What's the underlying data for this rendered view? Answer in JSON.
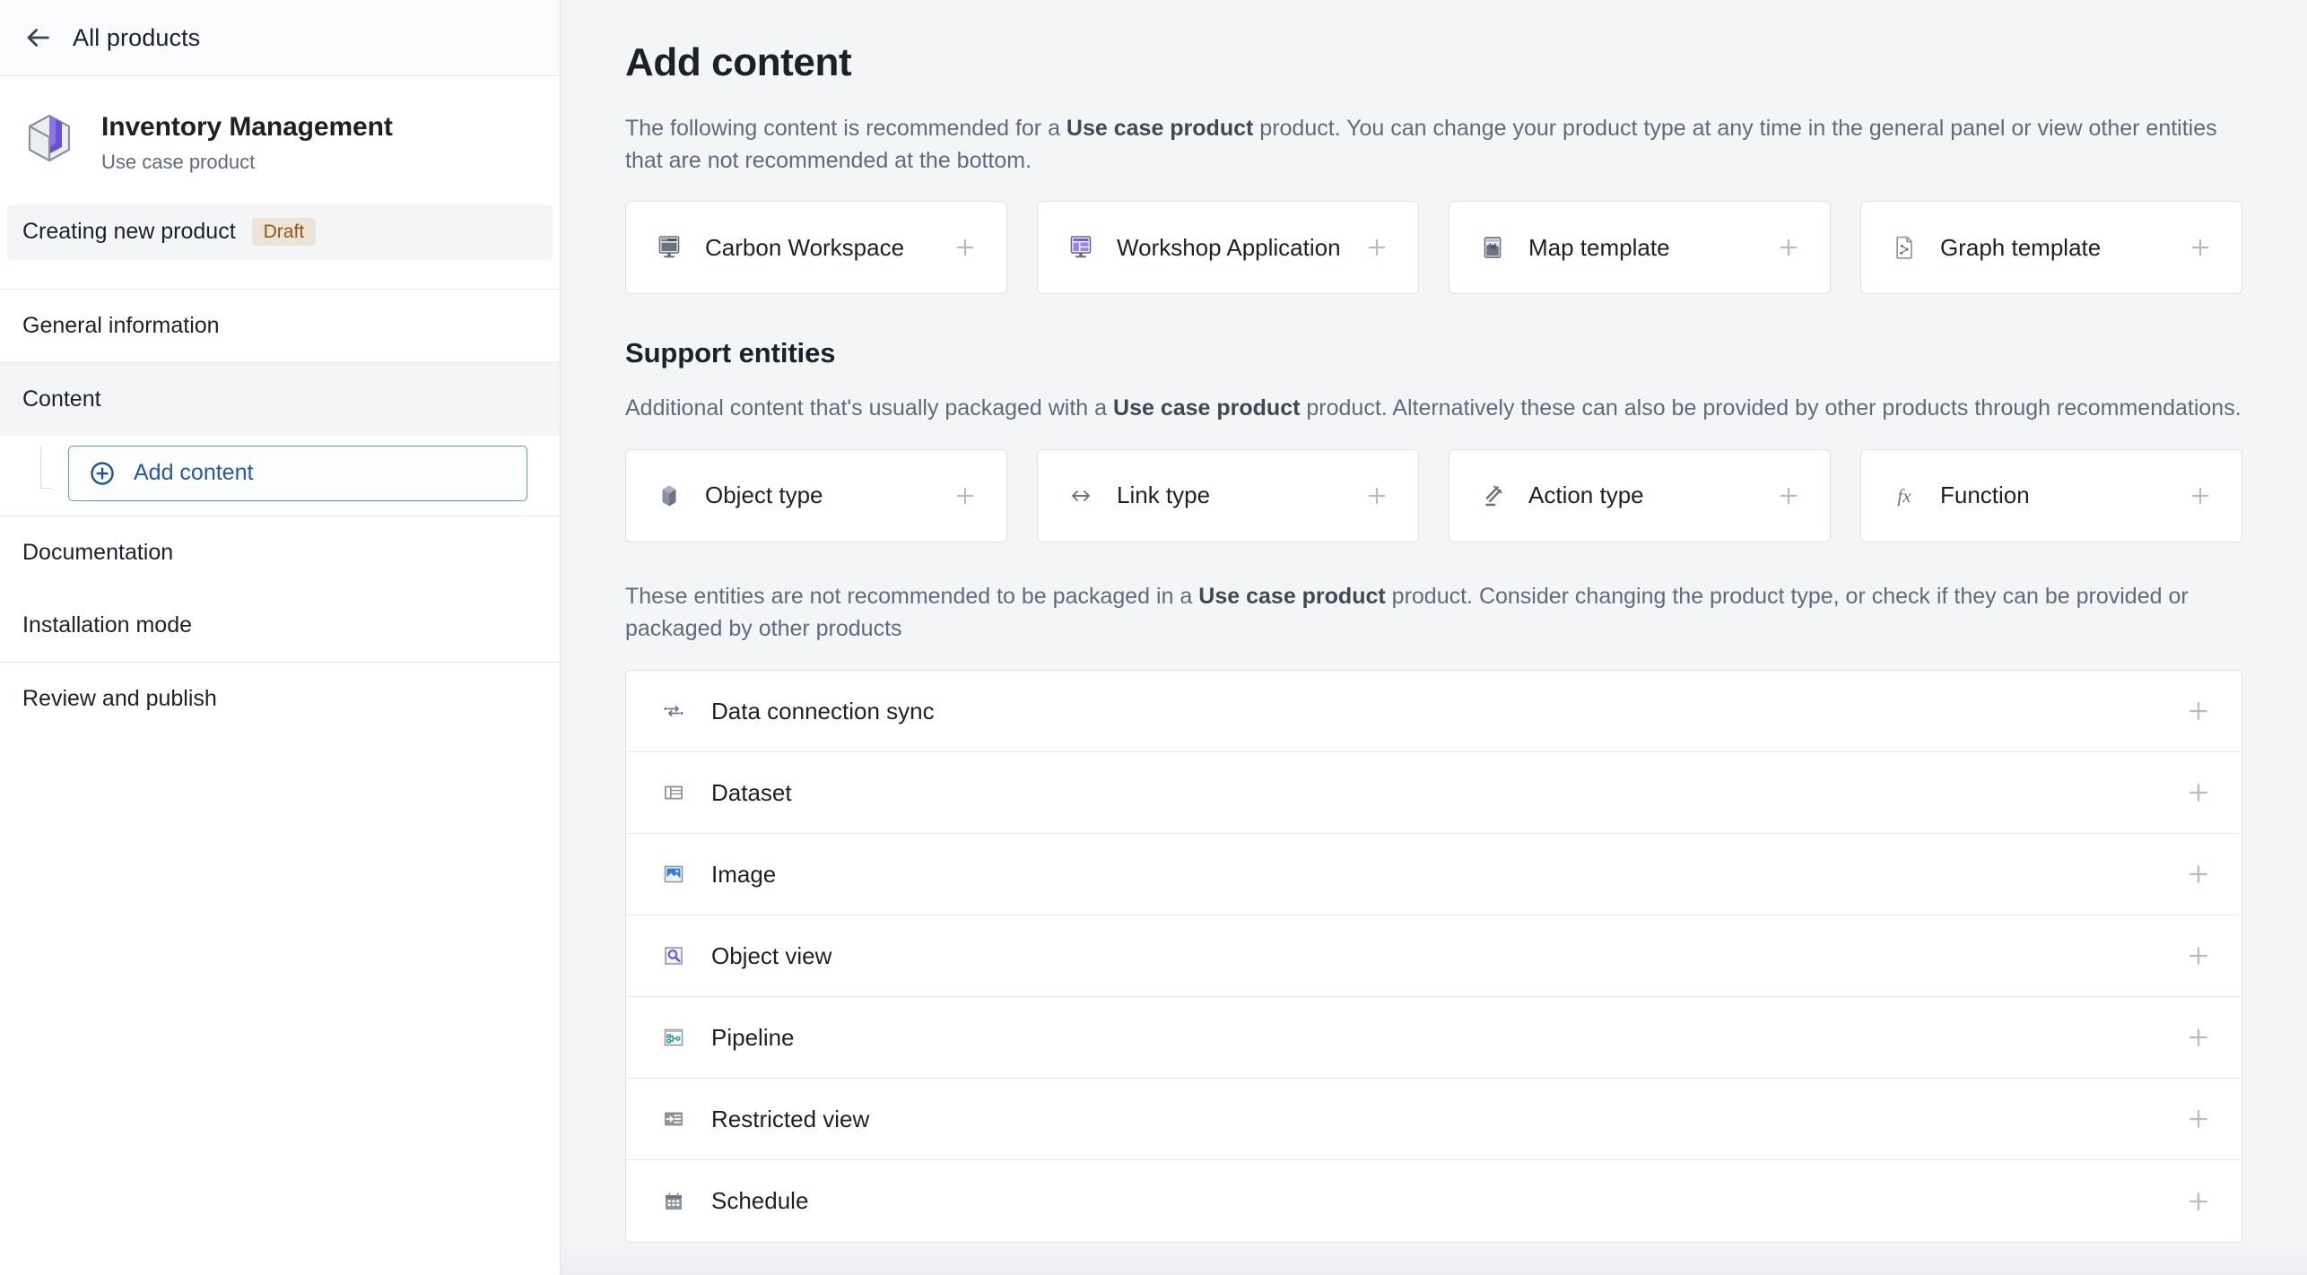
{
  "sidebar": {
    "back": {
      "label": "All products",
      "icon": "arrow-left-icon"
    },
    "product": {
      "title": "Inventory Management",
      "subtitle": "Use case product",
      "icon": "cube-product-icon"
    },
    "status": {
      "text": "Creating new product",
      "badge": "Draft"
    },
    "nav": [
      {
        "label": "General information",
        "active": false
      },
      {
        "label": "Content",
        "active": true
      },
      {
        "label": "Documentation",
        "active": false
      },
      {
        "label": "Installation mode",
        "active": false
      },
      {
        "label": "Review and publish",
        "active": false
      }
    ],
    "add_content": {
      "label": "Add content",
      "icon": "plus-circle-icon"
    }
  },
  "main": {
    "title": "Add content",
    "intro": {
      "before": "The following content is recommended for a ",
      "bold": "Use case product",
      "after": " product. You can change your product type at any time in the general panel or view other entities that are not recommended at the bottom."
    },
    "recommended": [
      {
        "label": "Carbon Workspace",
        "icon": "carbon-workspace-icon",
        "action": "plus-icon"
      },
      {
        "label": "Workshop Application",
        "icon": "workshop-application-icon",
        "action": "plus-icon"
      },
      {
        "label": "Map template",
        "icon": "map-template-icon",
        "action": "plus-icon"
      },
      {
        "label": "Graph template",
        "icon": "graph-template-icon",
        "action": "plus-icon"
      }
    ],
    "support": {
      "title": "Support entities",
      "desc": {
        "before": "Additional content that's usually packaged with a ",
        "bold": "Use case product",
        "after": " product. Alternatively these can also be provided by other products through recommendations."
      },
      "items": [
        {
          "label": "Object type",
          "icon": "object-type-icon",
          "action": "plus-icon"
        },
        {
          "label": "Link type",
          "icon": "link-type-icon",
          "action": "plus-icon"
        },
        {
          "label": "Action type",
          "icon": "action-type-icon",
          "action": "plus-icon"
        },
        {
          "label": "Function",
          "icon": "function-icon",
          "action": "plus-icon"
        }
      ]
    },
    "not_recommended": {
      "note": {
        "before": "These entities are not recommended to be packaged in a ",
        "bold": "Use case product",
        "after": " product. Consider changing the product type, or check if they can be provided or packaged by other products"
      },
      "items": [
        {
          "label": "Data connection sync",
          "icon": "data-connection-sync-icon",
          "action": "plus-icon"
        },
        {
          "label": "Dataset",
          "icon": "dataset-icon",
          "action": "plus-icon"
        },
        {
          "label": "Image",
          "icon": "image-icon",
          "action": "plus-icon"
        },
        {
          "label": "Object view",
          "icon": "object-view-icon",
          "action": "plus-icon"
        },
        {
          "label": "Pipeline",
          "icon": "pipeline-icon",
          "action": "plus-icon"
        },
        {
          "label": "Restricted view",
          "icon": "restricted-view-icon",
          "action": "plus-icon"
        },
        {
          "label": "Schedule",
          "icon": "schedule-icon",
          "action": "plus-icon"
        }
      ]
    }
  },
  "colors": {
    "accent_blue": "#2458a8",
    "badge_bg": "#eee3d9",
    "badge_text": "#935610",
    "purple": "#7c5cde",
    "surface": "#ffffff",
    "canvas": "#f4f5f7"
  }
}
